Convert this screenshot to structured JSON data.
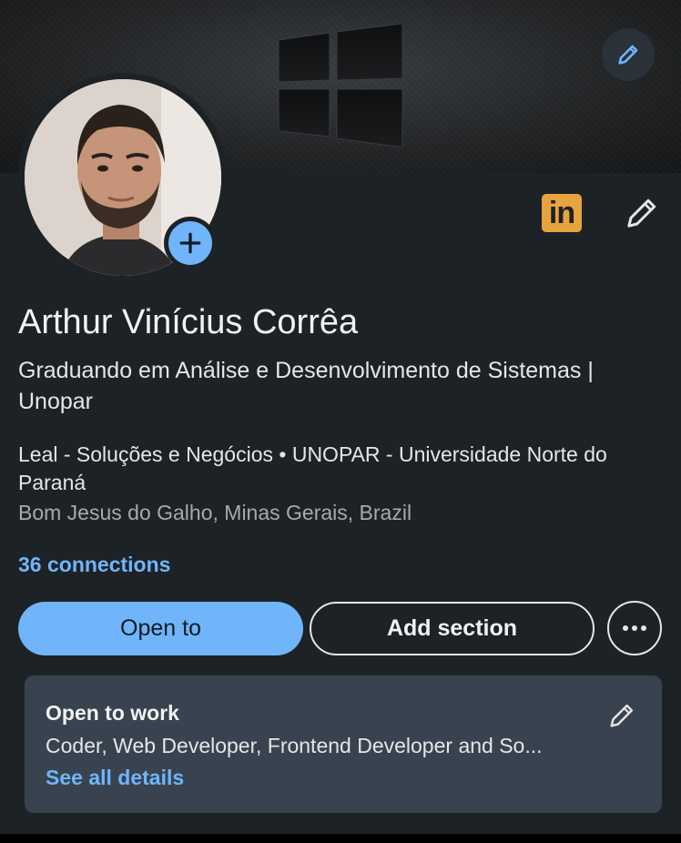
{
  "banner": {
    "edit_icon": "pencil-icon"
  },
  "profile": {
    "name": "Arthur Vinícius Corrêa",
    "headline": "Graduando em Análise e Desenvolvimento de Sistemas | Unopar",
    "company_line": "Leal - Soluções e Negócios • UNOPAR - Universidade Norte do Paraná",
    "location": "Bom Jesus do Galho, Minas Gerais, Brazil",
    "connections": "36 connections",
    "linkedin_badge": "in",
    "add_photo_icon": "plus-icon",
    "edit_icon": "pencil-icon"
  },
  "actions": {
    "open_to": "Open to",
    "add_section": "Add section",
    "more_icon": "more-horizontal-icon"
  },
  "open_to_work": {
    "title": "Open to work",
    "roles": "Coder, Web Developer, Frontend Developer and So...",
    "link": "See all details"
  },
  "colors": {
    "accent": "#70b5f9",
    "background": "#1d2226",
    "card": "#38434f",
    "linkedin_badge": "#e7a33e"
  }
}
